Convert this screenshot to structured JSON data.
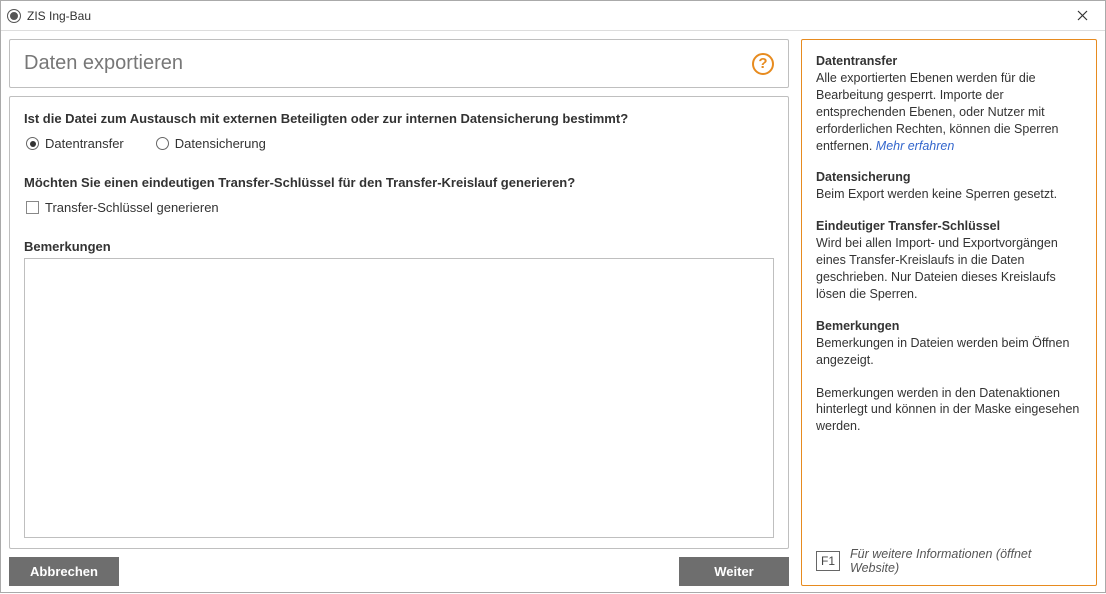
{
  "window": {
    "title": "ZIS Ing-Bau"
  },
  "header": {
    "title": "Daten exportieren"
  },
  "form": {
    "question1": "Ist die Datei zum Austausch mit externen Beteiligten oder zur internen Datensicherung bestimmt?",
    "radio_transfer": "Datentransfer",
    "radio_backup": "Datensicherung",
    "question2": "Möchten Sie einen eindeutigen Transfer-Schlüssel für den Transfer-Kreislauf generieren?",
    "check_genkey": "Transfer-Schlüssel generieren",
    "remarks_label": "Bemerkungen",
    "remarks_value": ""
  },
  "buttons": {
    "cancel": "Abbrechen",
    "next": "Weiter"
  },
  "help": {
    "s1h": "Datentransfer",
    "s1t": "Alle exportierten Ebenen werden für die Bearbeitung gesperrt. Importe der entsprechenden Ebenen, oder Nutzer mit erforderlichen Rechten, können die Sperren entfernen.",
    "s1link": "Mehr erfahren",
    "s2h": "Datensicherung",
    "s2t": "Beim Export werden keine Sperren gesetzt.",
    "s3h": "Eindeutiger Transfer-Schlüssel",
    "s3t": "Wird bei allen Import- und Exportvorgängen eines Transfer-Kreislaufs in die Daten geschrieben. Nur Dateien dieses Kreislaufs lösen die Sperren.",
    "s4h": "Bemerkungen",
    "s4t": "Bemerkungen in Dateien werden beim Öffnen angezeigt.",
    "s5t": "Bemerkungen werden in den Datenaktionen hinterlegt und können in der Maske eingesehen werden.",
    "footer_badge": "F1",
    "footer_text": "Für weitere Informationen (öffnet Website)"
  }
}
